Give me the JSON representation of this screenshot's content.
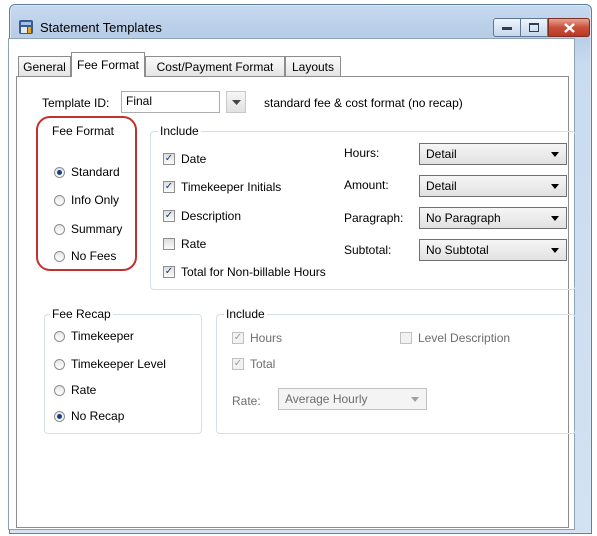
{
  "window": {
    "title": "Statement Templates",
    "title_icon": "statement-templates-icon"
  },
  "tabs": [
    {
      "label": "General",
      "active": false
    },
    {
      "label": "Fee Format",
      "active": true
    },
    {
      "label": "Cost/Payment Format",
      "active": false
    },
    {
      "label": "Layouts",
      "active": false
    }
  ],
  "template": {
    "id_label": "Template ID:",
    "id_value": "Final",
    "description": "standard fee & cost format (no recap)"
  },
  "fee_format": {
    "title": "Fee Format",
    "options": [
      {
        "label": "Standard",
        "selected": true
      },
      {
        "label": "Info Only",
        "selected": false
      },
      {
        "label": "Summary",
        "selected": false
      },
      {
        "label": "No Fees",
        "selected": false
      }
    ]
  },
  "include": {
    "title": "Include",
    "checks": [
      {
        "label": "Date",
        "checked": true
      },
      {
        "label": "Timekeeper Initials",
        "checked": true
      },
      {
        "label": "Description",
        "checked": true
      },
      {
        "label": "Rate",
        "checked": false
      },
      {
        "label": "Total for Non-billable Hours",
        "checked": true
      }
    ],
    "hours_label": "Hours:",
    "hours_value": "Detail",
    "amount_label": "Amount:",
    "amount_value": "Detail",
    "paragraph_label": "Paragraph:",
    "paragraph_value": "No Paragraph",
    "subtotal_label": "Subtotal:",
    "subtotal_value": "No Subtotal"
  },
  "fee_recap": {
    "title": "Fee Recap",
    "options": [
      {
        "label": "Timekeeper",
        "selected": false
      },
      {
        "label": "Timekeeper Level",
        "selected": false
      },
      {
        "label": "Rate",
        "selected": false
      },
      {
        "label": "No Recap",
        "selected": true
      }
    ]
  },
  "recap_include": {
    "title": "Include",
    "hours_label": "Hours",
    "total_label": "Total",
    "level_label": "Level Description",
    "rate_label": "Rate:",
    "rate_value": "Average Hourly"
  },
  "colors": {
    "annotation": "#c0312f",
    "radio_dot": "#1a3f8c",
    "window_frame": "#5f7f9e"
  }
}
